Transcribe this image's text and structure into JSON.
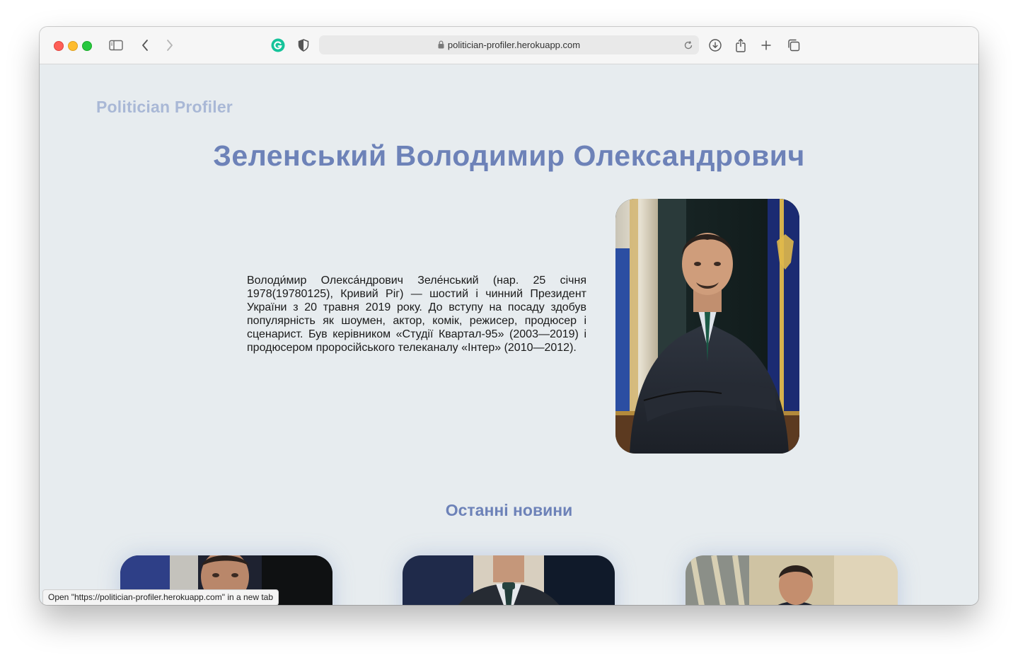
{
  "browser": {
    "url": "politician-profiler.herokuapp.com",
    "status_tooltip": "Open \"https://politician-profiler.herokuapp.com\" in a new tab"
  },
  "page": {
    "brand": "Politician Profiler",
    "politician_name": "Зеленський Володимир Олександрович",
    "bio": "Володи́мир Олекса́ндрович Зеле́нський (нар. 25 січня 1978(19780125), Кривий Ріг) — шостий і чинний Президент України з 20 травня 2019 року. До вступу на посаду здобув популярність як шоумен, актор, комік, режисер, продюсер і сценарист. Був керівником «Студії Квартал-95» (2003—2019) і продюсером проросійського телеканалу «Інтер» (2010—2012).",
    "news_heading": "Останні новини"
  },
  "colors": {
    "accent": "#6d82b8",
    "brand": "#a9b8d6",
    "page_bg": "#e7ecef"
  }
}
